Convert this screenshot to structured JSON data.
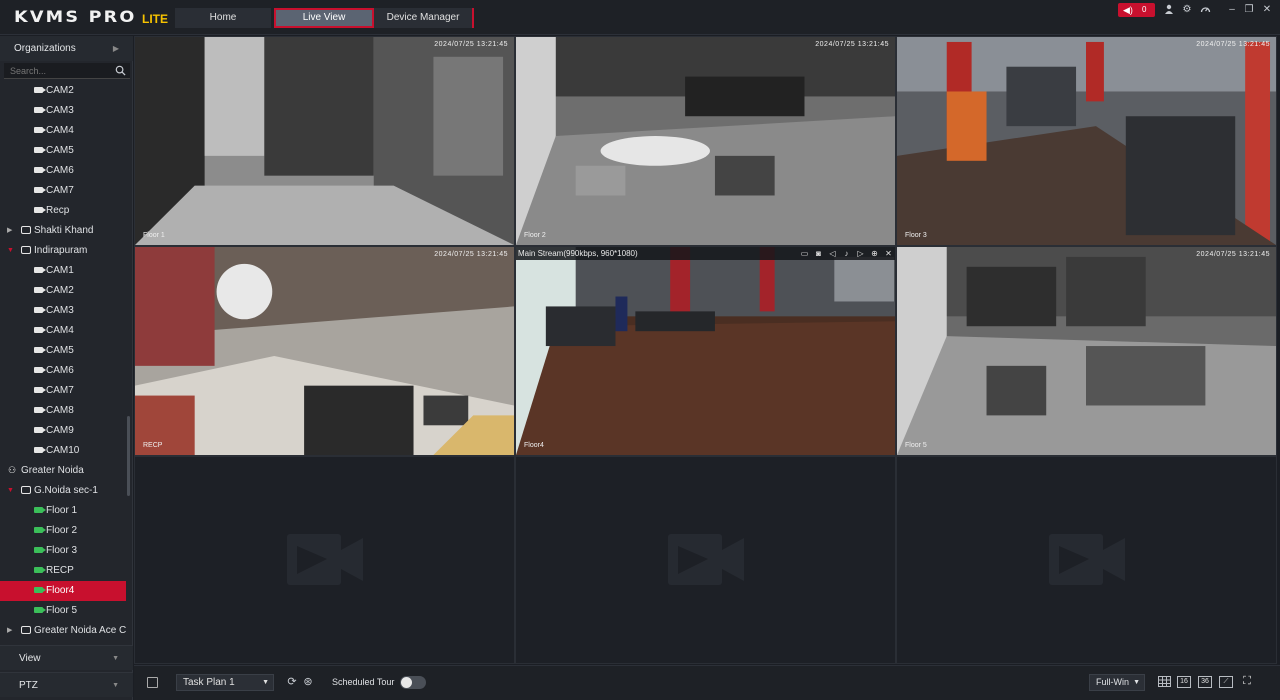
{
  "app": {
    "name": "KVMS PRO",
    "edition": "LITE"
  },
  "nav_tabs": [
    {
      "label": "Home",
      "active": false
    },
    {
      "label": "Live View",
      "active": true
    },
    {
      "label": "Device Manager",
      "active": false
    }
  ],
  "topbar": {
    "alarm_count": "0",
    "icons": [
      "user-icon",
      "settings-gear-icon",
      "dashboard-icon",
      "minimize-icon",
      "restore-icon",
      "close-icon"
    ]
  },
  "sidebar": {
    "header": "Organizations",
    "search_placeholder": "Search...",
    "tree": [
      {
        "label": "CAM2",
        "kind": "camera"
      },
      {
        "label": "CAM3",
        "kind": "camera"
      },
      {
        "label": "CAM4",
        "kind": "camera"
      },
      {
        "label": "CAM5",
        "kind": "camera"
      },
      {
        "label": "CAM6",
        "kind": "camera"
      },
      {
        "label": "CAM7",
        "kind": "camera"
      },
      {
        "label": "Recp",
        "kind": "camera"
      },
      {
        "label": "Shakti Khand",
        "kind": "group",
        "expanded": false
      },
      {
        "label": "Indirapuram",
        "kind": "group",
        "expanded": true
      },
      {
        "label": "CAM1",
        "kind": "camera"
      },
      {
        "label": "CAM2",
        "kind": "camera"
      },
      {
        "label": "CAM3",
        "kind": "camera"
      },
      {
        "label": "CAM4",
        "kind": "camera"
      },
      {
        "label": "CAM5",
        "kind": "camera"
      },
      {
        "label": "CAM6",
        "kind": "camera"
      },
      {
        "label": "CAM7",
        "kind": "camera"
      },
      {
        "label": "CAM8",
        "kind": "camera"
      },
      {
        "label": "CAM9",
        "kind": "camera"
      },
      {
        "label": "CAM10",
        "kind": "camera"
      },
      {
        "label": "Greater Noida",
        "kind": "org"
      },
      {
        "label": "G.Noida sec-1",
        "kind": "group",
        "expanded": true
      },
      {
        "label": "Floor 1",
        "kind": "camera-live"
      },
      {
        "label": "Floor 2",
        "kind": "camera-live"
      },
      {
        "label": "Floor 3",
        "kind": "camera-live"
      },
      {
        "label": "RECP",
        "kind": "camera-live"
      },
      {
        "label": "Floor4",
        "kind": "camera-live",
        "selected": true
      },
      {
        "label": "Floor 5",
        "kind": "camera-live"
      },
      {
        "label": "Greater Noida Ace City",
        "kind": "group",
        "expanded": false
      }
    ],
    "sections": [
      "View",
      "PTZ"
    ]
  },
  "cells": [
    {
      "label": "Floor 1",
      "timestamp": "2024/07/25 13:21:45",
      "feed": "feed-bw-entrance"
    },
    {
      "label": "Floor 2",
      "timestamp": "2024/07/25 13:21:45",
      "feed": "feed-bw-bench"
    },
    {
      "label": "Floor 3",
      "timestamp": "2024/07/25 13:21:45",
      "feed": "feed-color-treadmills"
    },
    {
      "label": "RECP",
      "timestamp": "2024/07/25 13:21:45",
      "feed": "feed-color-reception"
    },
    {
      "label": "Floor4",
      "timestamp": "",
      "stream": "Main Stream(990kbps, 960*1080)",
      "feed": "feed-color-wood-floor"
    },
    {
      "label": "Floor 5",
      "timestamp": "2024/07/25 13:21:45",
      "feed": "feed-bw-machines"
    },
    {
      "label": "",
      "feed": "empty"
    },
    {
      "label": "",
      "feed": "empty"
    },
    {
      "label": "",
      "feed": "empty"
    }
  ],
  "bottombar": {
    "task_plan": "Task Plan 1",
    "scheduled_tour_label": "Scheduled Tour",
    "scheduled_tour_on": false,
    "window_mode": "Full-Win",
    "layout_buttons": [
      "16",
      "36"
    ]
  },
  "colors": {
    "accent": "#c8102e",
    "brand_lite": "#f7c300",
    "live_icon": "#3bbf5a"
  }
}
